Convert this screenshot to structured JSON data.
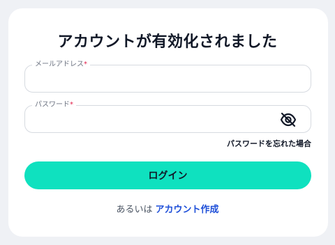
{
  "title": "アカウントが有効化されました",
  "email": {
    "label": "メールアドレス",
    "required_mark": "*",
    "value": ""
  },
  "password": {
    "label": "パスワード",
    "required_mark": "*",
    "value": "",
    "toggle_icon": "eye-slash-icon"
  },
  "forgot_password": "パスワードを忘れた場合",
  "login_button": "ログイン",
  "footer": {
    "prefix": "あるいは",
    "create_account": "アカウント作成"
  },
  "colors": {
    "accent": "#0fe1bf",
    "link": "#1d4ed8",
    "required": "#e11d48",
    "background": "#eff1f5"
  }
}
